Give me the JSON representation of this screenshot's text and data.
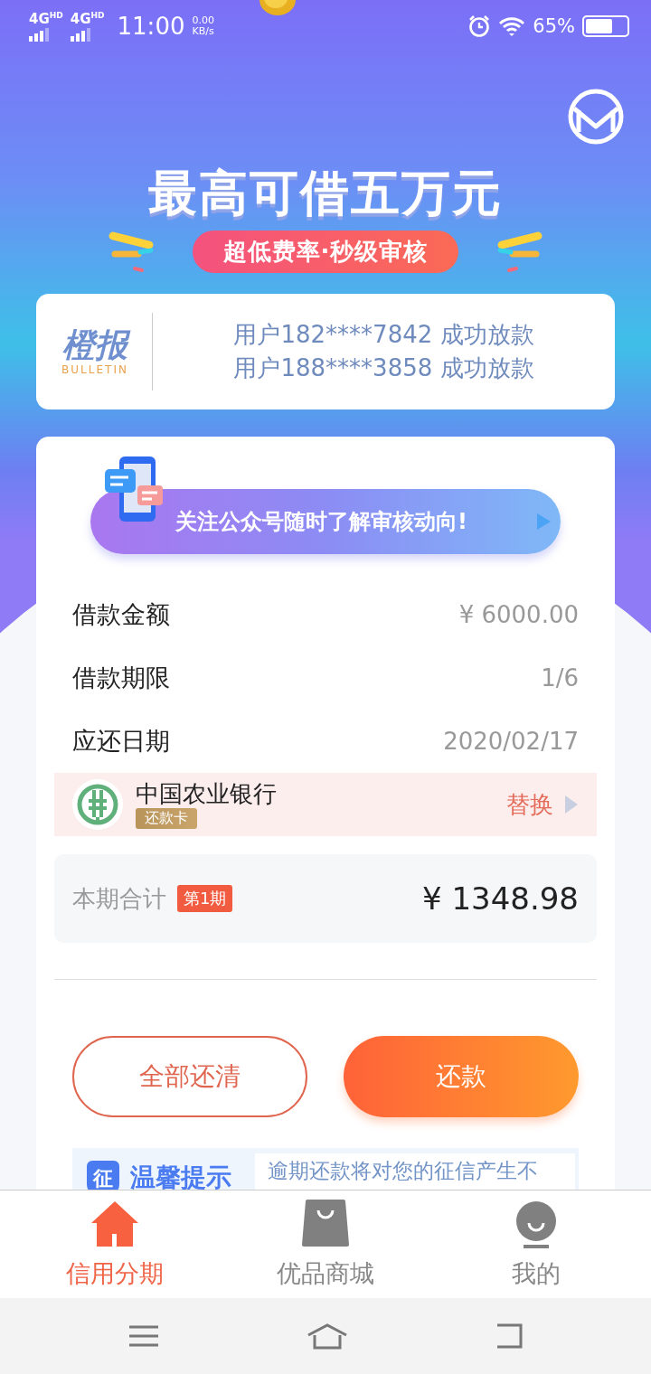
{
  "status_bar": {
    "networks": [
      "4G$^{HD}$",
      "4G$^{HD}$"
    ],
    "time": "11:00",
    "speed": "0.00",
    "speed_unit": "KB/s",
    "battery": "65%"
  },
  "hero": {
    "title": "最高可借五万元",
    "subtitle": "超低费率·秒级审核"
  },
  "bulletin": {
    "logo": "橙报",
    "logo_sub": "BULLETIN",
    "messages": [
      "用户182****7842 成功放款",
      "用户188****3858 成功放款"
    ]
  },
  "banner": {
    "text": "关注公众号随时了解审核动向!"
  },
  "details": [
    {
      "label": "借款金额",
      "value": "¥ 6000.00"
    },
    {
      "label": "借款期限",
      "value": "1/6"
    },
    {
      "label": "应还日期",
      "value": "2020/02/17"
    }
  ],
  "bank": {
    "name": "中国农业银行",
    "tag": "还款卡",
    "action": "替换"
  },
  "total": {
    "label": "本期合计",
    "badge": "第1期",
    "amount": "¥ 1348.98"
  },
  "buttons": [
    {
      "label": "全部还清",
      "kind": "outline"
    },
    {
      "label": "还款",
      "kind": "primary"
    }
  ],
  "tip": {
    "icon_text": "征",
    "title": "温馨提示",
    "text": "逾期还款将对您的征信产生不"
  },
  "tabs": [
    {
      "label": "信用分期",
      "selected": true
    },
    {
      "label": "优品商城",
      "selected": false
    },
    {
      "label": "我的",
      "selected": false
    }
  ]
}
